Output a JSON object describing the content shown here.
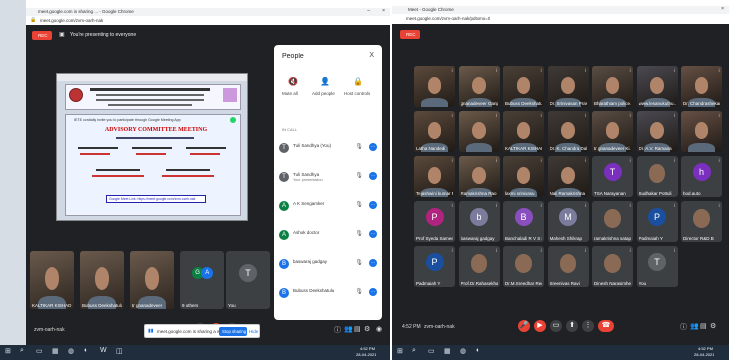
{
  "left_window": {
    "title": "meet.google.com is sharing ... - Google Chrome",
    "url": "meet.google.com/zvm-oarh-nak",
    "rec": "REC",
    "presenting_banner": "You're presenting to everyone",
    "slide": {
      "title": "ADVISORY COMMITTEE MEETING",
      "subtitle": "IETE cordially invite you to participate through Google Meeting App",
      "link_text": "Google Meet Link: https://meet.google.com/zvm-oarh-nak"
    },
    "people_panel": {
      "title": "People",
      "close": "X",
      "actions": [
        "Mute all",
        "Add people",
        "Host controls"
      ],
      "section_label": "IN CALL",
      "participants": [
        {
          "initial": "T",
          "name": "Tuli Sandhya (You)",
          "sub": "",
          "color": "#5f6368"
        },
        {
          "initial": "T",
          "name": "Tuli Sandhya",
          "sub": "Your presentation",
          "color": "#5f6368"
        },
        {
          "initial": "A",
          "name": "A K Sengamker",
          "sub": "",
          "color": "#0b8043"
        },
        {
          "initial": "A",
          "name": "Ashok doctor",
          "sub": "",
          "color": "#0b8043"
        },
        {
          "initial": "B",
          "name": "baswaraj gadgay",
          "sub": "",
          "color": "#1a73e8"
        },
        {
          "initial": "B",
          "name": "Bubuss Deekshatulu",
          "sub": "",
          "color": "#1a73e8"
        }
      ]
    },
    "bottom_tiles": [
      {
        "name": "KALTIKAR KISHAD",
        "type": "video"
      },
      {
        "name": "Bubuss Deekshatulu",
        "type": "video"
      },
      {
        "name": "tr gnanadeveer",
        "type": "video"
      },
      {
        "name": "9 others",
        "type": "others"
      },
      {
        "name": "You",
        "type": "avatar",
        "initial": "T"
      }
    ],
    "meeting_code": "zvm-oarh-nak",
    "sharing_notice": "meet.google.com is sharing a window.",
    "stop_sharing": "Stop sharing",
    "hide": "Hide"
  },
  "right_window": {
    "title": "Meet - Google Chrome",
    "url": "meet.google.com/zvm-oarh-nak/pdtxmo=0",
    "rec": "REC",
    "time": "4:52 PM",
    "meeting_code": "zvm-oarh-nak",
    "video_tiles": [
      "",
      "gnanadeveer Ganp...",
      "Bubuss Deekshatu...",
      "Dr. Srinivasan Prasad",
      "Bharathiam police...",
      "www.lesanukuthu...",
      "Dr. Chandrashekar",
      "Latha Nandedi",
      "",
      "KALTIKAR KISHAD",
      "Dr. K. Chandra Dalal Ki...",
      "tr gnanadeveer Ki...",
      "Dr. A.V. Ramana",
      "",
      "Tejashwini kumar Rao",
      "Ramakrishna Rao",
      "laxmi srinivasu",
      "Nali Ramakrishna"
    ],
    "avatar_tiles": [
      {
        "initial": "T",
        "name": "TSA Narayanan",
        "color": "#7b2fbf"
      },
      {
        "initial": "",
        "name": "Sudhakar Pottuli",
        "color": ""
      },
      {
        "initial": "h",
        "name": "hod.auto",
        "color": "#7b2fbf"
      },
      {
        "initial": "P",
        "name": "Prof Syeda Sameen ...",
        "color": "#b0237f"
      },
      {
        "initial": "b",
        "name": "baswaraj gadgay",
        "color": "#7b7b9c"
      },
      {
        "initial": "B",
        "name": "Banchaladi R V S Ra...",
        "color": "#8a4fbf"
      },
      {
        "initial": "M",
        "name": "Mahesh Shikrap",
        "color": "#7b7b9c"
      },
      {
        "initial": "",
        "name": "ramakrishna satapa...",
        "color": ""
      },
      {
        "initial": "P",
        "name": "Padmaiah Y",
        "color": "#1a4fa0"
      },
      {
        "initial": "",
        "name": "Director R&D B",
        "color": ""
      },
      {
        "initial": "P",
        "name": "Padmaiah Y",
        "color": "#1a4fa0"
      },
      {
        "initial": "",
        "name": "Prof.Dr.Rahasekha...",
        "color": ""
      },
      {
        "initial": "",
        "name": "Dr.M.Sreedhar Reddy",
        "color": ""
      },
      {
        "initial": "",
        "name": "Sreenivas Ravi",
        "color": ""
      },
      {
        "initial": "",
        "name": "Dinesh Narasimhe",
        "color": ""
      },
      {
        "initial": "T",
        "name": "You",
        "color": "#5f6368"
      }
    ]
  },
  "taskbar_left": {
    "time": "4:52 PM",
    "date": "28-04-2021"
  },
  "taskbar_right": {
    "time": "4:52 PM",
    "date": "28-04-2021"
  }
}
